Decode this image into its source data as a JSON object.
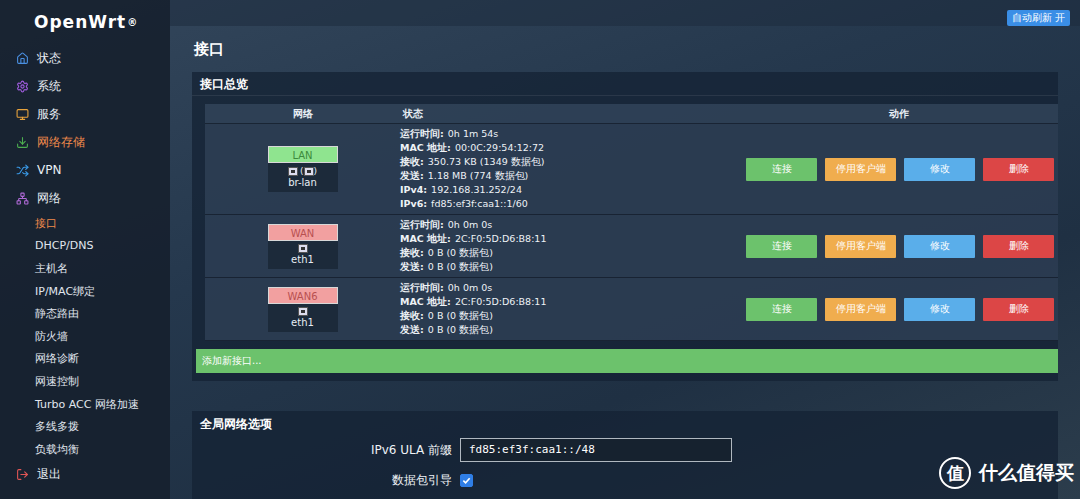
{
  "header": {
    "logo": "OpenWrt",
    "logo_mark": "®",
    "auto_refresh": "自动刷新 开"
  },
  "sidebar": {
    "items": [
      {
        "label": "状态",
        "color": "#4a90e2",
        "highlighted": false,
        "expanded": false
      },
      {
        "label": "系统",
        "color": "#a05ce0",
        "highlighted": false,
        "expanded": false
      },
      {
        "label": "服务",
        "color": "#e8a33c",
        "highlighted": false,
        "expanded": false
      },
      {
        "label": "网络存储",
        "color": "#4caf50",
        "highlighted": true,
        "expanded": false
      },
      {
        "label": "VPN",
        "color": "#3a9ae8",
        "highlighted": false,
        "expanded": false
      },
      {
        "label": "网络",
        "color": "#b06ad8",
        "highlighted": false,
        "expanded": true
      }
    ],
    "subitems": [
      {
        "label": "接口",
        "selected": true
      },
      {
        "label": "DHCP/DNS",
        "selected": false
      },
      {
        "label": "主机名",
        "selected": false
      },
      {
        "label": "IP/MAC绑定",
        "selected": false
      },
      {
        "label": "静态路由",
        "selected": false
      },
      {
        "label": "防火墙",
        "selected": false
      },
      {
        "label": "网络诊断",
        "selected": false
      },
      {
        "label": "网速控制",
        "selected": false
      },
      {
        "label": "Turbo ACC 网络加速",
        "selected": false
      },
      {
        "label": "多线多拨",
        "selected": false
      },
      {
        "label": "负载均衡",
        "selected": false
      }
    ],
    "logout": {
      "label": "退出",
      "color": "#e05555"
    }
  },
  "page_title": "接口",
  "panel_title": "接口总览",
  "columns": [
    "网络",
    "状态",
    "动作"
  ],
  "actions": [
    {
      "label": "连接",
      "color": "#6cc26c"
    },
    {
      "label": "停用客户端",
      "color": "#f0ad4e"
    },
    {
      "label": "修改",
      "color": "#5aaeea"
    },
    {
      "label": "删除",
      "color": "#dc4646"
    }
  ],
  "interfaces": [
    {
      "name": "LAN",
      "color": "#8fe48f",
      "device": "br-lan",
      "icons": 2,
      "status": [
        {
          "label": "运行时间:",
          "value": "0h 1m 54s"
        },
        {
          "label": "MAC 地址:",
          "value": "00:0C:29:54:12:72"
        },
        {
          "label": "接收:",
          "value": "350.73 KB (1349 数据包)"
        },
        {
          "label": "发送:",
          "value": "1.18 MB (774 数据包)"
        },
        {
          "label": "IPv4:",
          "value": "192.168.31.252/24"
        },
        {
          "label": "IPv6:",
          "value": "fd85:ef3f:caa1::1/60"
        }
      ]
    },
    {
      "name": "WAN",
      "color": "#f2a0a0",
      "device": "eth1",
      "icons": 1,
      "status": [
        {
          "label": "运行时间:",
          "value": "0h 0m 0s"
        },
        {
          "label": "MAC 地址:",
          "value": "2C:F0:5D:D6:B8:11"
        },
        {
          "label": "接收:",
          "value": "0 B (0 数据包)"
        },
        {
          "label": "发送:",
          "value": "0 B (0 数据包)"
        }
      ]
    },
    {
      "name": "WAN6",
      "color": "#f2a0a0",
      "device": "eth1",
      "icons": 1,
      "status": [
        {
          "label": "运行时间:",
          "value": "0h 0m 0s"
        },
        {
          "label": "MAC 地址:",
          "value": "2C:F0:5D:D6:B8:11"
        },
        {
          "label": "接收:",
          "value": "0 B (0 数据包)"
        },
        {
          "label": "发送:",
          "value": "0 B (0 数据包)"
        }
      ]
    }
  ],
  "add_button": "添加新接口...",
  "global_title": "全局网络选项",
  "fields": [
    {
      "kind": "text",
      "label": "IPv6 ULA 前缀",
      "value": "fd85:ef3f:caa1::/48"
    },
    {
      "kind": "checkbox",
      "label": "数据包引导",
      "checked": true
    }
  ],
  "watermark": {
    "mark": "值",
    "text": "什么值得买"
  }
}
